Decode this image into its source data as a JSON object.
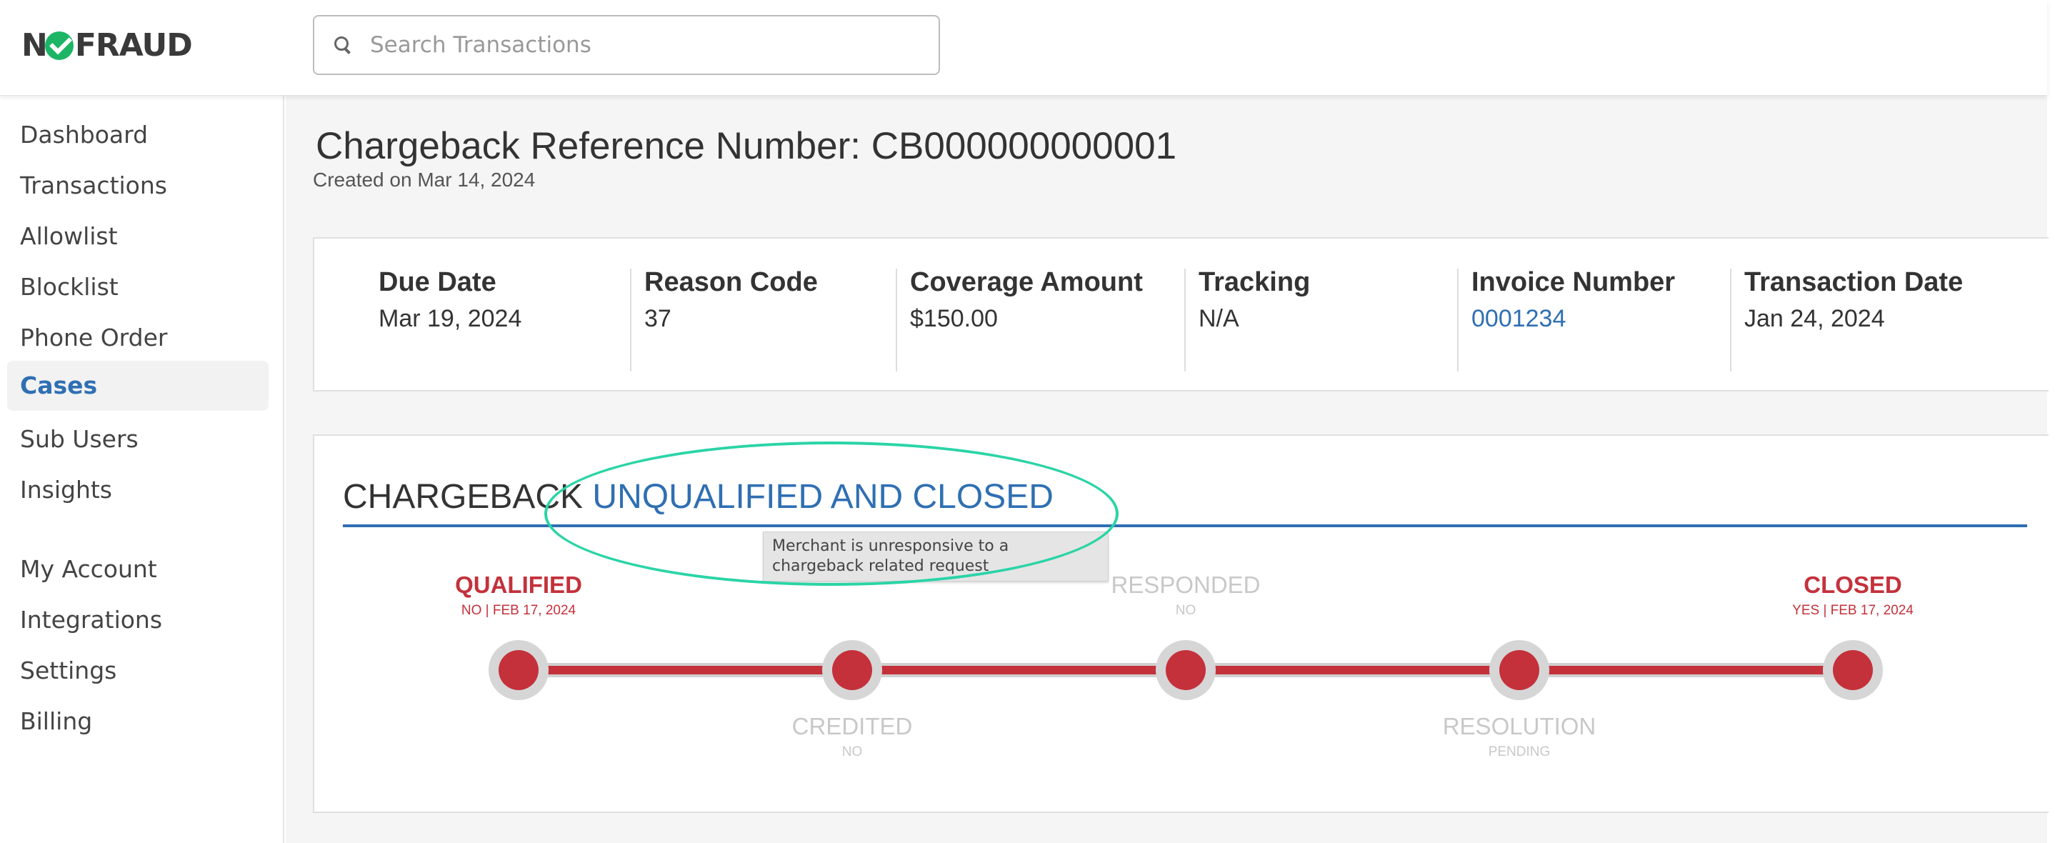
{
  "header": {
    "logo_text": "N✔FRAUD",
    "logo_left": "N",
    "logo_right": "FRAUD",
    "search_placeholder": "Search Transactions"
  },
  "sidebar": {
    "items": [
      {
        "label": "Dashboard",
        "active": false
      },
      {
        "label": "Transactions",
        "active": false
      },
      {
        "label": "Allowlist",
        "active": false
      },
      {
        "label": "Blocklist",
        "active": false
      },
      {
        "label": "Phone Order",
        "active": false
      },
      {
        "label": "Cases",
        "active": true
      },
      {
        "label": "Sub Users",
        "active": false
      },
      {
        "label": "Insights",
        "active": false
      },
      {
        "label": "My Account",
        "active": false
      },
      {
        "label": "Integrations",
        "active": false
      },
      {
        "label": "Settings",
        "active": false
      },
      {
        "label": "Billing",
        "active": false
      }
    ]
  },
  "main": {
    "title": "Chargeback Reference Number: CB000000000001",
    "created": "Created on Mar 14, 2024",
    "info": [
      {
        "label": "Due Date",
        "value": "Mar 19, 2024"
      },
      {
        "label": "Reason Code",
        "value": "37"
      },
      {
        "label": "Coverage Amount",
        "value": "$150.00"
      },
      {
        "label": "Tracking",
        "value": "N/A"
      },
      {
        "label": "Invoice Number",
        "value": "0001234"
      },
      {
        "label": "Transaction Date",
        "value": "Jan 24, 2024"
      }
    ],
    "status": {
      "prefix": "CHARGEBACK ",
      "value": "UNQUALIFIED AND CLOSED",
      "tooltip": "Merchant is unresponsive to a chargeback related request",
      "steps": [
        {
          "name": "QUALIFIED",
          "detail": "NO | FEB 17, 2024"
        },
        {
          "name": "CREDITED",
          "detail": "NO"
        },
        {
          "name": "RESPONDED",
          "detail": "NO"
        },
        {
          "name": "RESOLUTION",
          "detail": "PENDING"
        },
        {
          "name": "CLOSED",
          "detail": "YES | FEB 17, 2024"
        }
      ]
    }
  },
  "colors": {
    "accent_blue": "#2f6fb3",
    "timeline_red": "#c4313b",
    "highlight_teal": "#2ad4a6",
    "logo_green": "#1bb565"
  }
}
